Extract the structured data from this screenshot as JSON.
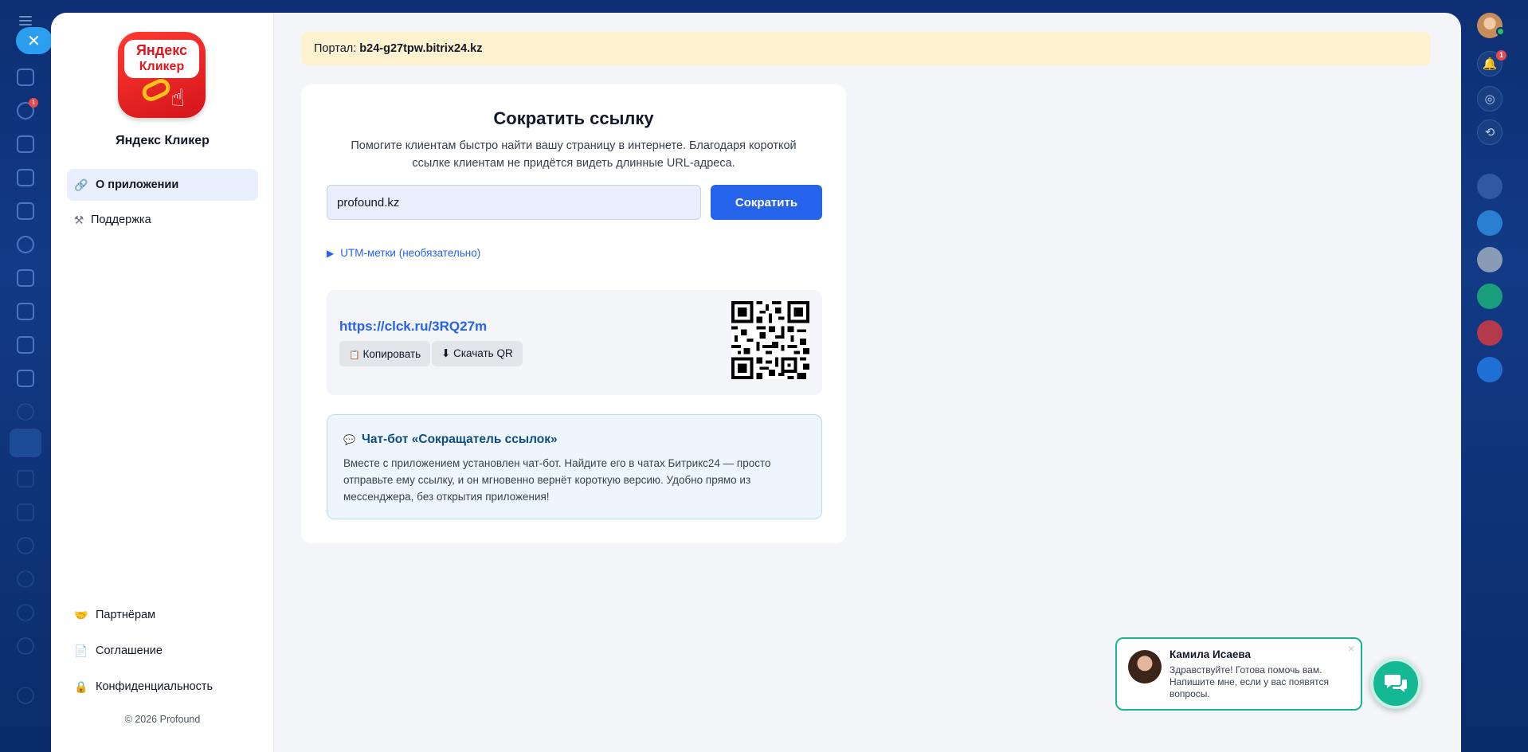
{
  "app": {
    "name": "Яндекс Кликер",
    "logo_line1": "Яндекс",
    "logo_line2": "Кликер"
  },
  "sidebar": {
    "items": [
      {
        "label": "О приложении",
        "icon": "link-icon",
        "active": true
      },
      {
        "label": "Поддержка",
        "icon": "tools-icon"
      }
    ],
    "bottom_items": [
      {
        "label": "Партнёрам",
        "icon": "handshake-icon"
      },
      {
        "label": "Соглашение",
        "icon": "document-icon"
      },
      {
        "label": "Конфиденциальность",
        "icon": "lock-icon"
      }
    ],
    "copyright": "© 2026 Profound"
  },
  "banner": {
    "prefix": "Портал:",
    "portal": "b24-g27tpw.bitrix24.kz"
  },
  "shortener": {
    "title": "Сократить ссылку",
    "subtitle": "Помогите клиентам быстро найти вашу страницу в интернете. Благодаря короткой ссылке клиентам не придётся видеть длинные URL-адреса.",
    "input_value": "profound.kz",
    "submit_label": "Сократить",
    "utm_toggle": "UTM-метки (необязательно)"
  },
  "result": {
    "short_url": "https://clck.ru/3RQ27m",
    "copy_label": "Копировать",
    "download_label": "Скачать QR"
  },
  "chatbot": {
    "title": "Чат-бот «Сокращатель ссылок»",
    "text": "Вместе с приложением установлен чат-бот. Найдите его в чатах Битрикс24 — просто отправьте ему ссылку, и он мгновенно вернёт короткую версию. Удобно прямо из мессенджера, без открытия приложения!"
  },
  "chat_widget": {
    "name": "Камила Исаева",
    "message": "Здравствуйте! Готова помочь вам. Напишите мне, если у вас появятся вопросы."
  },
  "portal_rail": {
    "left_badge": "1",
    "notifications_badge": "1"
  },
  "colors": {
    "accent": "#2563eb",
    "banner_bg": "#fdf2d0",
    "chat_accent": "#1bb491"
  }
}
